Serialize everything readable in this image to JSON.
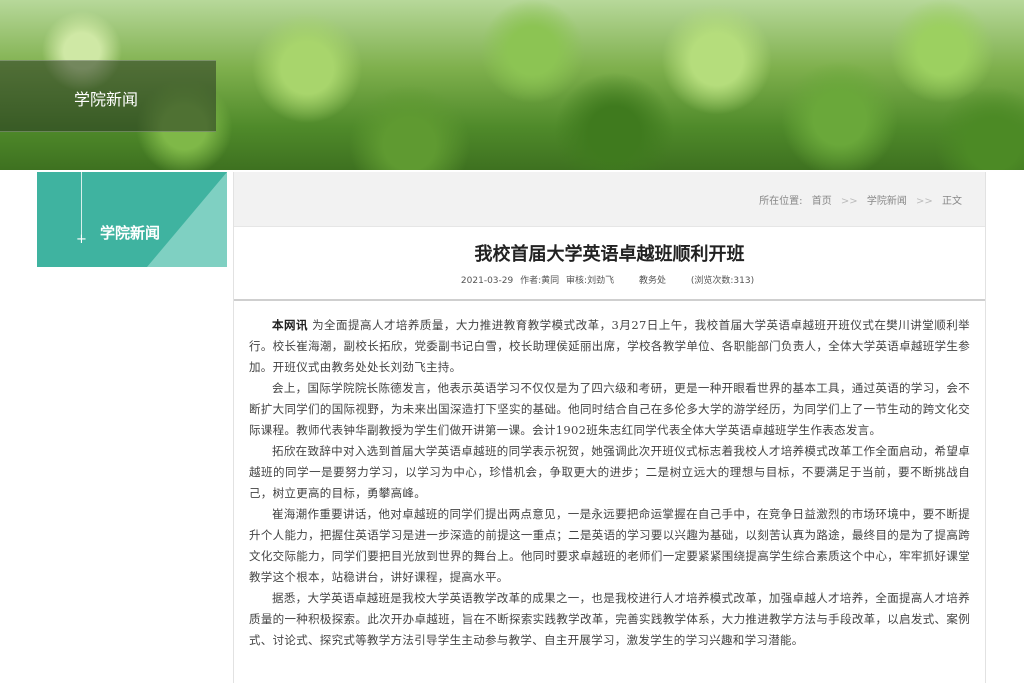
{
  "banner": {
    "section_title": "学院新闻"
  },
  "sidebar": {
    "title": "学院新闻"
  },
  "breadcrumb": {
    "prefix": "所在位置:",
    "home": "首页",
    "separator": ">>",
    "section": "学院新闻",
    "current": "正文"
  },
  "article": {
    "title": "我校首届大学英语卓越班顺利开班",
    "date": "2021-03-29",
    "author": "作者:黄同",
    "reviewer": "审核:刘劲飞",
    "department": "教务处",
    "views": "(浏览次数:313)",
    "lead": "本网讯",
    "paragraphs": [
      "为全面提高人才培养质量，大力推进教育教学模式改革，3月27日上午，我校首届大学英语卓越班开班仪式在樊川讲堂顺利举行。校长崔海潮，副校长拓欣，党委副书记白雪，校长助理侯延丽出席，学校各教学单位、各职能部门负责人，全体大学英语卓越班学生参加。开班仪式由教务处处长刘劲飞主持。",
      "会上，国际学院院长陈德发言，他表示英语学习不仅仅是为了四六级和考研，更是一种开眼看世界的基本工具，通过英语的学习，会不断扩大同学们的国际视野，为未来出国深造打下坚实的基础。他同时结合自己在多伦多大学的游学经历，为同学们上了一节生动的跨文化交际课程。教师代表钟华副教授为学生们做开讲第一课。会计1902班朱志红同学代表全体大学英语卓越班学生作表态发言。",
      "拓欣在致辞中对入选到首届大学英语卓越班的同学表示祝贺，她强调此次开班仪式标志着我校人才培养模式改革工作全面启动，希望卓越班的同学一是要努力学习，以学习为中心，珍惜机会，争取更大的进步；二是树立远大的理想与目标，不要满足于当前，要不断挑战自己，树立更高的目标，勇攀高峰。",
      "崔海潮作重要讲话，他对卓越班的同学们提出两点意见，一是永远要把命运掌握在自己手中，在竞争日益激烈的市场环境中，要不断提升个人能力，把握住英语学习是进一步深造的前提这一重点；二是英语的学习要以兴趣为基础，以刻苦认真为路途，最终目的是为了提高跨文化交际能力，同学们要把目光放到世界的舞台上。他同时要求卓越班的老师们一定要紧紧围绕提高学生综合素质这个中心，牢牢抓好课堂教学这个根本，站稳讲台，讲好课程，提高水平。",
      "据悉，大学英语卓越班是我校大学英语教学改革的成果之一，也是我校进行人才培养模式改革，加强卓越人才培养，全面提高人才培养质量的一种积极探索。此次开办卓越班，旨在不断探索实践教学改革，完善实践教学体系，大力推进教学方法与手段改革，以启发式、案例式、讨论式、探究式等教学方法引导学生主动参与教学、自主开展学习，激发学生的学习兴趣和学习潜能。"
    ]
  }
}
